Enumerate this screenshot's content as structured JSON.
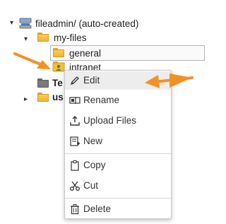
{
  "tree": {
    "root": {
      "label": "fileadmin/ (auto-created)",
      "icon": "storage-icon"
    },
    "my_files": {
      "label": "my-files",
      "icon": "folder-open-icon"
    },
    "general": {
      "label": "general",
      "icon": "folder-icon"
    },
    "intranet": {
      "label": "intranet",
      "icon": "user-folder-icon"
    },
    "te_folder": {
      "label": "Te",
      "icon": "folder-icon"
    },
    "us_folder": {
      "label": "us",
      "icon": "folder-icon"
    }
  },
  "context_menu": {
    "items": [
      {
        "label": "Edit",
        "icon": "pencil-icon"
      },
      {
        "label": "Rename",
        "icon": "rename-icon"
      },
      {
        "label": "Upload Files",
        "icon": "upload-icon"
      },
      {
        "label": "New",
        "icon": "new-file-icon"
      },
      {
        "label": "Copy",
        "icon": "clipboard-icon"
      },
      {
        "label": "Cut",
        "icon": "scissors-icon"
      },
      {
        "label": "Delete",
        "icon": "trash-icon"
      }
    ]
  },
  "colors": {
    "arrow": "#f39224",
    "folder": "#f5bd3d",
    "hover": "#ededed"
  }
}
